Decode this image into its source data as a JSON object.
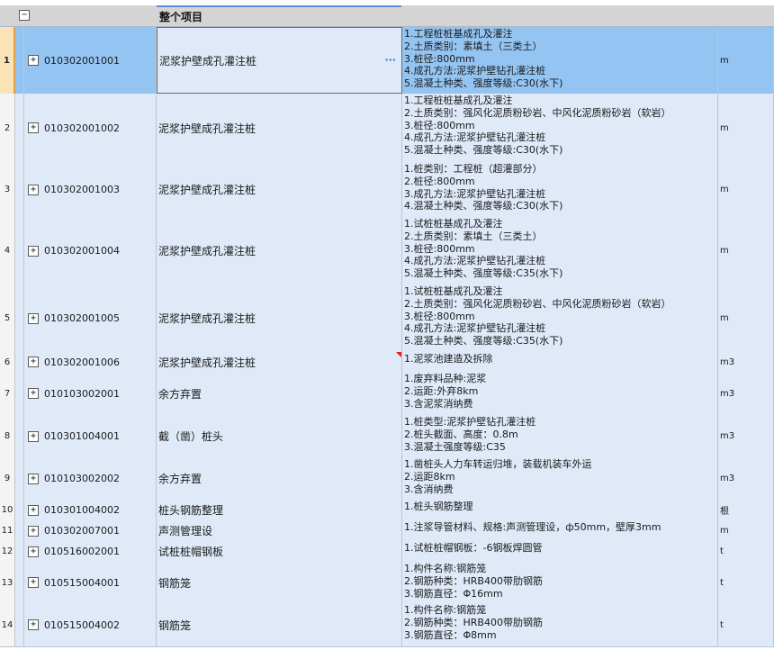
{
  "group": {
    "collapse_glyph": "−",
    "title": "整个项目"
  },
  "expand_glyph": "+",
  "ellipsis": "···",
  "rows": [
    {
      "idx": "1",
      "code": "010302001001",
      "name": "泥浆护壁成孔灌注桩",
      "features": [
        "1.工程桩桩基成孔及灌注",
        "2.土质类别：素填土（三类土）",
        "3.桩径:800mm",
        "4.成孔方法:泥浆护壁钻孔灌注桩",
        "5.混凝土种类、强度等级:C30(水下)"
      ],
      "unit": "m"
    },
    {
      "idx": "2",
      "code": "010302001002",
      "name": "泥浆护壁成孔灌注桩",
      "features": [
        "1.工程桩桩基成孔及灌注",
        "2.土质类别：强风化泥质粉砂岩、中风化泥质粉砂岩（软岩）",
        "3.桩径:800mm",
        "4.成孔方法:泥浆护壁钻孔灌注桩",
        "5.混凝土种类、强度等级:C30(水下)"
      ],
      "unit": "m"
    },
    {
      "idx": "3",
      "code": "010302001003",
      "name": "泥浆护壁成孔灌注桩",
      "features": [
        "1.桩类别：工程桩（超灌部分）",
        "2.桩径:800mm",
        "3.成孔方法:泥浆护壁钻孔灌注桩",
        "4.混凝土种类、强度等级:C30(水下)"
      ],
      "unit": "m"
    },
    {
      "idx": "4",
      "code": "010302001004",
      "name": "泥浆护壁成孔灌注桩",
      "features": [
        "1.试桩桩基成孔及灌注",
        "2.土质类别：素填土（三类土）",
        "3.桩径:800mm",
        "4.成孔方法:泥浆护壁钻孔灌注桩",
        "5.混凝土种类、强度等级:C35(水下)"
      ],
      "unit": "m"
    },
    {
      "idx": "5",
      "code": "010302001005",
      "name": "泥浆护壁成孔灌注桩",
      "features": [
        "1.试桩桩基成孔及灌注",
        "2.土质类别：强风化泥质粉砂岩、中风化泥质粉砂岩（软岩）",
        "3.桩径:800mm",
        "4.成孔方法:泥浆护壁钻孔灌注桩",
        "5.混凝土种类、强度等级:C35(水下)"
      ],
      "unit": "m"
    },
    {
      "idx": "6",
      "code": "010302001006",
      "name": "泥浆护壁成孔灌注桩",
      "features": [
        "1.泥浆池建造及拆除"
      ],
      "unit": "m3"
    },
    {
      "idx": "7",
      "code": "010103002001",
      "name": "余方弃置",
      "features": [
        "1.废弃料品种:泥浆",
        "2.运距:外弃8km",
        "3.含泥浆消纳费"
      ],
      "unit": "m3"
    },
    {
      "idx": "8",
      "code": "010301004001",
      "name": "截（凿）桩头",
      "features": [
        "1.桩类型:泥浆护壁钻孔灌注桩",
        "2.桩头截面、高度：0.8m",
        "3.混凝土强度等级:C35"
      ],
      "unit": "m3"
    },
    {
      "idx": "9",
      "code": "010103002002",
      "name": "余方弃置",
      "features": [
        "1.凿桩头人力车转运归堆，装载机装车外运",
        "2.运距8km",
        "3.含消纳费"
      ],
      "unit": "m3"
    },
    {
      "idx": "10",
      "code": "010301004002",
      "name": "桩头钢筋整理",
      "features": [
        "1.桩头钢筋整理"
      ],
      "unit": "根"
    },
    {
      "idx": "11",
      "code": "010302007001",
      "name": "声测管理设",
      "features": [
        "1.注浆导管材料、规格:声测管理设，ф50mm，壁厚3mm"
      ],
      "unit": "m"
    },
    {
      "idx": "12",
      "code": "010516002001",
      "name": "试桩桩帽钢板",
      "features": [
        "1.试桩桩帽钢板：-6钢板焊圆管"
      ],
      "unit": "t"
    },
    {
      "idx": "13",
      "code": "010515004001",
      "name": "钢筋笼",
      "features": [
        "1.构件名称:钢筋笼",
        "2.钢筋种类：HRB400带肋钢筋",
        "3.钢筋直径：Φ16mm"
      ],
      "unit": "t"
    },
    {
      "idx": "14",
      "code": "010515004002",
      "name": "钢筋笼",
      "features": [
        "1.构件名称:钢筋笼",
        "2.钢筋种类：HRB400带肋钢筋",
        "3.钢筋直径：Φ8mm"
      ],
      "unit": "t"
    }
  ]
}
